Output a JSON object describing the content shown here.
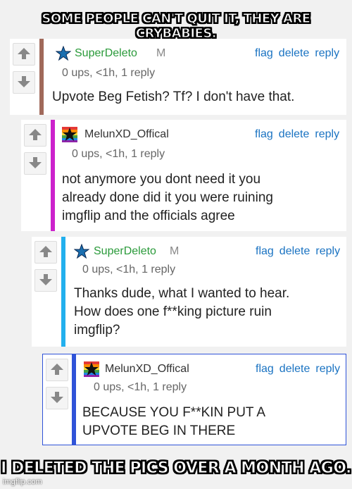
{
  "captions": {
    "top": "SOME PEOPLE CAN'T QUIT IT, THEY ARE CRYBABIES.",
    "bottom": "I DELETED THE PICS OVER A MONTH AGO."
  },
  "action_labels": {
    "flag": "flag",
    "delete": "delete",
    "reply": "reply"
  },
  "comments": [
    {
      "user": "SuperDeleto",
      "badge": "M",
      "meta": "0 ups, <1h, 1 reply",
      "text": "Upvote Beg Fetish? Tf? I don't have that.",
      "user_color": "#2a9a3a",
      "bar_color": "#a0695a",
      "avatar_icon": "star-icon"
    },
    {
      "user": "MelunXD_Offical",
      "badge": "",
      "meta": "0 ups, <1h, 1 reply",
      "text": "not anymore you dont need it you already done did it you were ruining imgflip and the officials agree",
      "user_color": "#333333",
      "bar_color": "#cc22cc",
      "avatar_icon": "rainbow-star-icon"
    },
    {
      "user": "SuperDeleto",
      "badge": "M",
      "meta": "0 ups, <1h, 1 reply",
      "text": "Thanks dude, what I wanted to hear. How does one f**king picture ruin imgflip?",
      "user_color": "#2a9a3a",
      "bar_color": "#22b0ee",
      "avatar_icon": "star-icon"
    },
    {
      "user": "MelunXD_Offical",
      "badge": "",
      "meta": "0 ups, <1h, 1 reply",
      "text": "BECAUSE YOU F**KIN PUT A UPVOTE BEG IN THERE",
      "user_color": "#333333",
      "bar_color": "#2f53d8",
      "avatar_icon": "rainbow-star-icon"
    }
  ],
  "watermark": "imgflip.com"
}
